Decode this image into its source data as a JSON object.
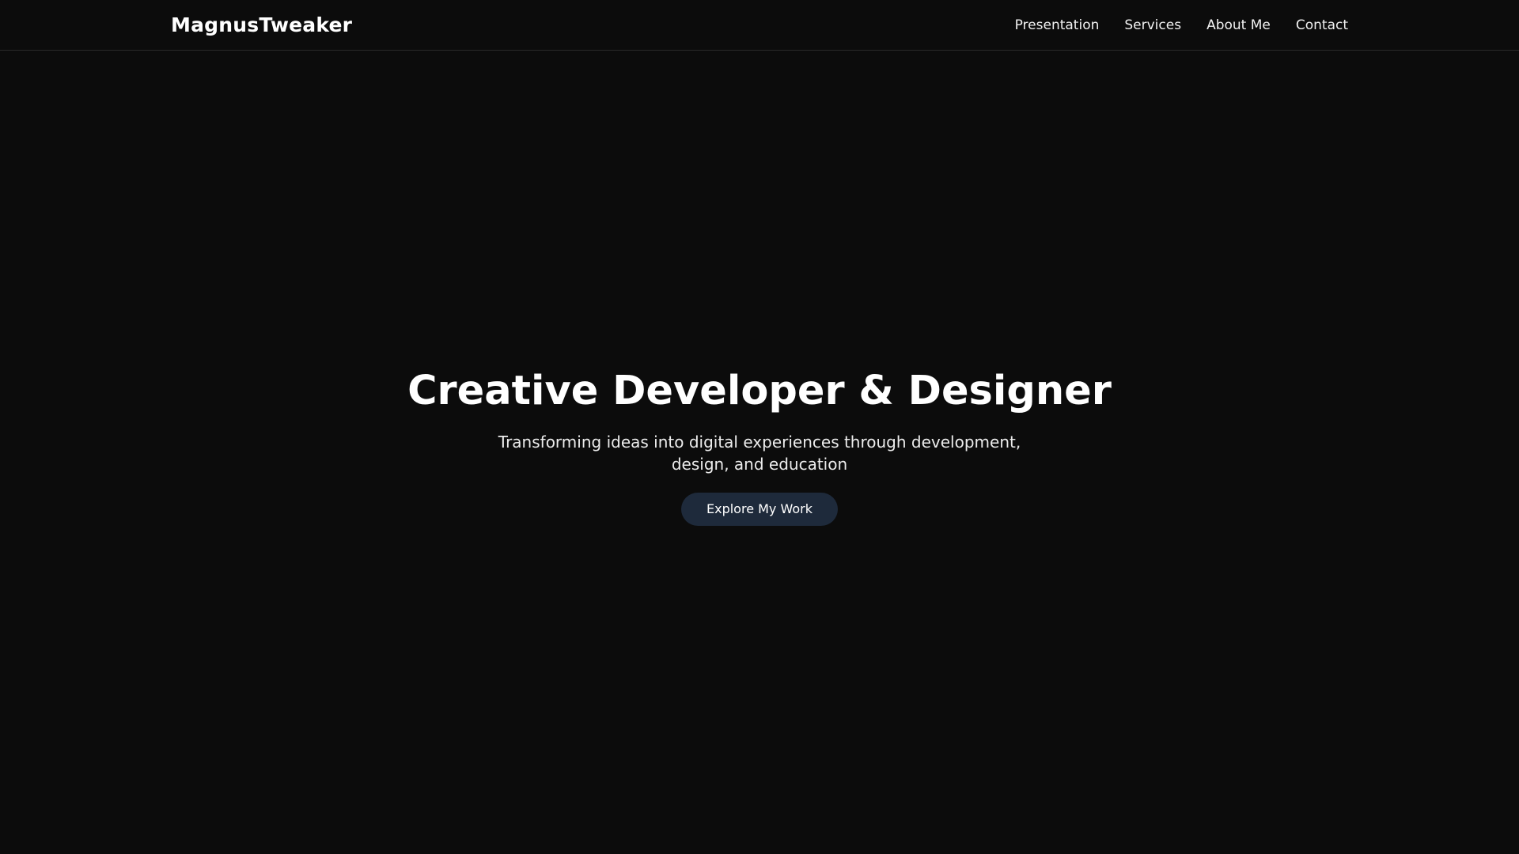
{
  "header": {
    "brand": "MagnusTweaker",
    "nav": [
      {
        "label": "Presentation"
      },
      {
        "label": "Services"
      },
      {
        "label": "About Me"
      },
      {
        "label": "Contact"
      }
    ]
  },
  "hero": {
    "title": "Creative Developer & Designer",
    "subtitle": "Transforming ideas into digital experiences through development, design, and education",
    "cta_label": "Explore My Work"
  },
  "colors": {
    "background": "#0c0c0c",
    "button": "#1e2a3b",
    "border": "#2a2a2a"
  }
}
